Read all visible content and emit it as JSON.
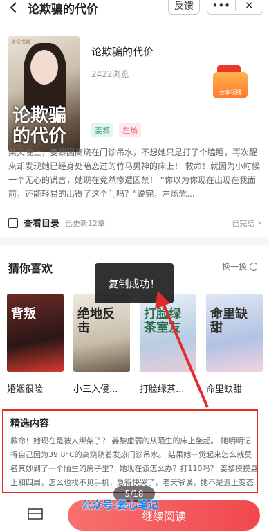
{
  "header": {
    "title": "论欺骗的代价",
    "feedback_label": "反馈",
    "more_label": "•••",
    "close_label": "✕"
  },
  "book": {
    "title": "论欺骗的代价",
    "cover_title": "论欺骗的代价",
    "cover_tag": "点众书城",
    "views": "2422浏览",
    "tags": [
      "姜黎",
      "左炀"
    ],
    "gift_label": "分享领钱",
    "synopsis": "某天晚上，姜黎因高烧在门诊吊水，不想她只是打了个瞌睡，再次醒来却发现她已经身处暗恋过的竹马男神的床上！ 救命！就因为小时候一个无心的谎言，她现在竟然惨遭囚禁！ “你以为你现在出现在我面前，还能轻易的出得了这个门吗？”说完，左炀危...",
    "toc_label": "查看目录",
    "updated": "已更新12章",
    "finished": "已完结"
  },
  "recommend": {
    "title": "猜你喜欢",
    "shuffle_label": "换一换",
    "books": [
      {
        "name": "婚姻很险",
        "cover": "背叛"
      },
      {
        "name": "小三入侵...",
        "cover": "绝地反击"
      },
      {
        "name": "打脸绿茶...",
        "cover": "打脸绿茶室友"
      },
      {
        "name": "命里缺甜",
        "cover": "命里缺甜"
      }
    ]
  },
  "toast": {
    "text": "复制成功！"
  },
  "featured": {
    "title": "精选内容",
    "text": "救命！她现在是被人绑架了？ 姜黎虚弱的从陌生的床上坐起。 她明明记得自己因为39.8°C的高烧躺着发热门诊吊水。 结果她一觉起来怎么就莫名其妙到了一个陌生的房子里？ 她现在该怎么办？打110吗？ 姜黎摸摸身上和四周，怎么也找不见手机，急得快哭了，老天爷诶，她不是遇上变态了吧？ 一阵脚步声在这时响起..."
  },
  "bottom": {
    "read_label": "继续阅读",
    "pager": "5/18"
  },
  "watermark": "公众号:姜心笔记",
  "colors": {
    "accent": "#f0484f",
    "annotation": "#e02b2b"
  }
}
